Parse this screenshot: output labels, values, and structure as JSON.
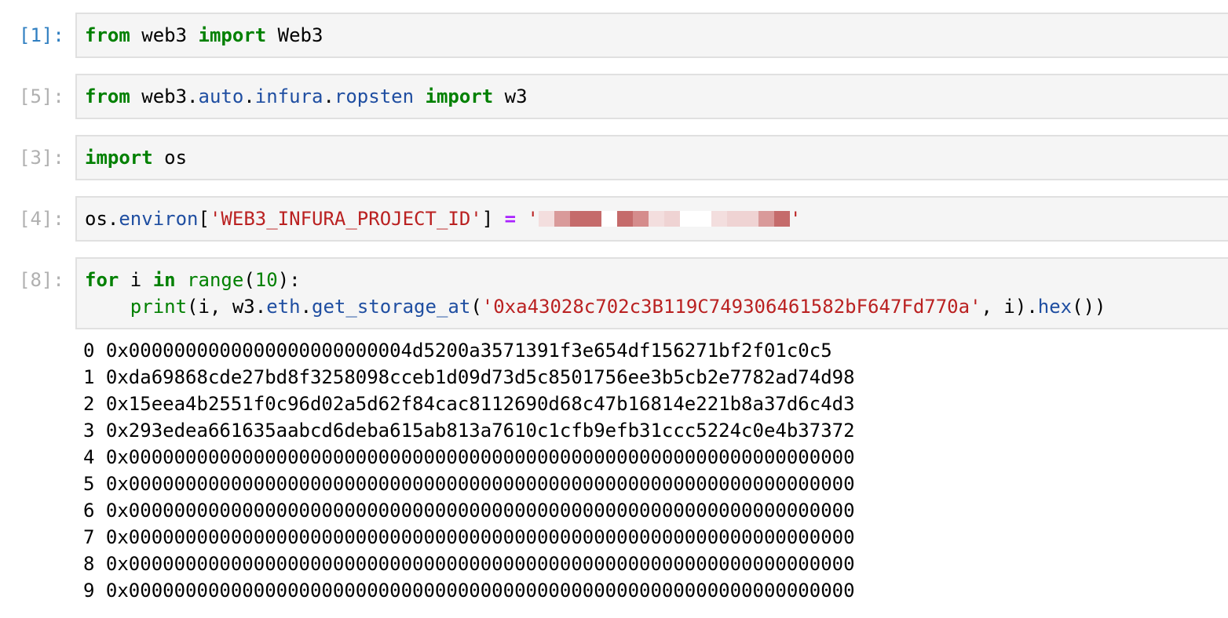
{
  "cells": [
    {
      "prompt": "[1]:",
      "tokens": {
        "t1": "from",
        "t2": " web3 ",
        "t3": "import",
        "t4": " Web3"
      }
    },
    {
      "prompt": "[5]:",
      "tokens": {
        "t1": "from",
        "t2": " web3",
        "t3": ".",
        "t4": "auto",
        "t5": ".",
        "t6": "infura",
        "t7": ".",
        "t8": "ropsten",
        "t9": " ",
        "t10": "import",
        "t11": " w3"
      }
    },
    {
      "prompt": "[3]:",
      "tokens": {
        "t1": "import",
        "t2": " os"
      }
    },
    {
      "prompt": "[4]:",
      "tokens": {
        "t1": "os",
        "t2": ".",
        "t3": "environ",
        "t4": "[",
        "t5": "'WEB3_INFURA_PROJECT_ID'",
        "t6": "] ",
        "t7": "=",
        "t8": " '",
        "t9": "'"
      },
      "redaction_colors": [
        "#f3dede",
        "#d99a9a",
        "#c56b6b",
        "#c56b6b",
        "#ffffff",
        "#c56b6b",
        "#d58c8c",
        "#f3dede",
        "#efd3d3",
        "#ffffff",
        "#ffffff",
        "#f3dede",
        "#efd3d3",
        "#efd3d3",
        "#d99a9a",
        "#c56b6b"
      ]
    },
    {
      "prompt": "[8]:",
      "line1": {
        "t1": "for",
        "t2": " i ",
        "t3": "in",
        "t4": " ",
        "t5": "range",
        "t6": "(",
        "t7": "10",
        "t8": "):"
      },
      "line2": {
        "t0": "    ",
        "t1": "print",
        "t2": "(i, w3",
        "t3": ".",
        "t4": "eth",
        "t5": ".",
        "t6": "get_storage_at",
        "t7": "(",
        "t8": "'0xa43028c702c3B119C749306461582bF647Fd770a'",
        "t9": ", i)",
        "t10": ".",
        "t11": "hex",
        "t12": "())"
      },
      "output": [
        "0 0x0000000000000000000000004d5200a3571391f3e654df156271bf2f01c0c5",
        "1 0xda69868cde27bd8f3258098cceb1d09d73d5c8501756ee3b5cb2e7782ad74d98",
        "2 0x15eea4b2551f0c96d02a5d62f84cac8112690d68c47b16814e221b8a37d6c4d3",
        "3 0x293edea661635aabcd6deba615ab813a7610c1cfb9efb31ccc5224c0e4b37372",
        "4 0x0000000000000000000000000000000000000000000000000000000000000000",
        "5 0x0000000000000000000000000000000000000000000000000000000000000000",
        "6 0x0000000000000000000000000000000000000000000000000000000000000000",
        "7 0x0000000000000000000000000000000000000000000000000000000000000000",
        "8 0x0000000000000000000000000000000000000000000000000000000000000000",
        "9 0x0000000000000000000000000000000000000000000000000000000000000000"
      ]
    }
  ]
}
